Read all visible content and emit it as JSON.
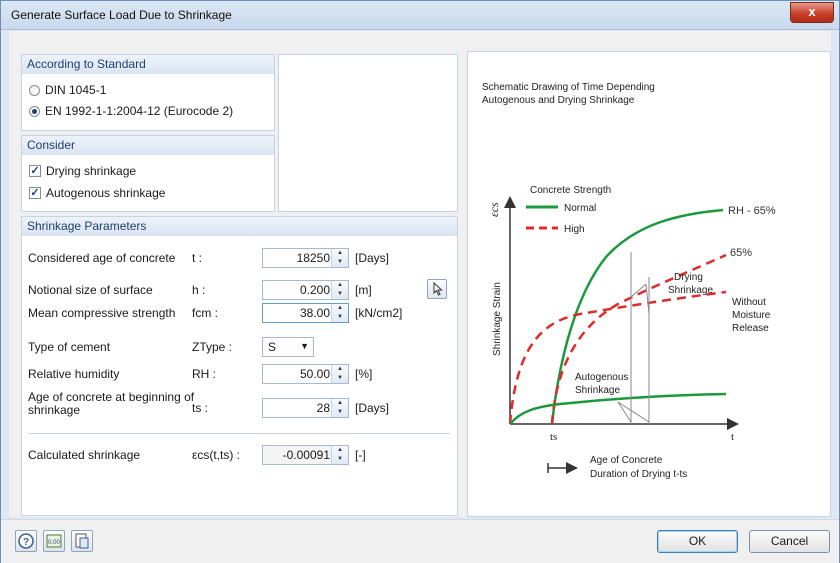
{
  "window": {
    "title": "Generate Surface Load Due to Shrinkage",
    "close_label": "x"
  },
  "standard": {
    "header": "According to Standard",
    "options": [
      "DIN 1045-1",
      "EN 1992-1-1:2004-12 (Eurocode 2)"
    ],
    "selected": "EN 1992-1-1:2004-12 (Eurocode 2)"
  },
  "consider": {
    "header": "Consider",
    "drying": "Drying shrinkage",
    "autogenous": "Autogenous shrinkage",
    "drying_checked": true,
    "autogenous_checked": true
  },
  "params": {
    "header": "Shrinkage Parameters",
    "age": {
      "label": "Considered age of concrete",
      "symbol": "t :",
      "value": "18250",
      "unit": "[Days]"
    },
    "notional": {
      "label": "Notional size of surface",
      "symbol": "h :",
      "value": "0.200",
      "unit": "[m]"
    },
    "strength": {
      "label": "Mean compressive strength",
      "symbol": "fcm :",
      "value": "38.00",
      "unit": "[kN/cm2]"
    },
    "cement": {
      "label": "Type of cement",
      "symbol": "ZType :",
      "value": "S"
    },
    "humidity": {
      "label": "Relative humidity",
      "symbol": "RH :",
      "value": "50.00",
      "unit": "[%]"
    },
    "ts": {
      "label_line1": "Age of concrete at beginning of",
      "label_line2": "shrinkage",
      "symbol": "ts :",
      "value": "28",
      "unit": "[Days]"
    },
    "result": {
      "label": "Calculated shrinkage",
      "symbol": "εcs(t,ts) :",
      "value": "-0.00091",
      "unit": "[-]"
    }
  },
  "diagram": {
    "title_line1": "Schematic Drawing of Time Depending",
    "title_line2": "Autogenous and Drying Shrinkage",
    "legend_title": "Concrete Strength",
    "legend_normal": "Normal",
    "legend_high": "High",
    "yaxis_symbol": "εcs",
    "yaxis_label": "Shrinkage Strain",
    "label_rh": "RH - 65%",
    "label_65": "65%",
    "label_drying_1": "Drying",
    "label_drying_2": "Shrinkage",
    "label_without_1": "Without",
    "label_without_2": "Moisture",
    "label_without_3": "Release",
    "label_auto_1": "Autogenous",
    "label_auto_2": "Shrinkage",
    "x_ts": "ts",
    "x_t": "t",
    "xcaption_1": "Age of Concrete",
    "xcaption_2": "Duration of Drying t-ts",
    "colors": {
      "normal": "#1a9a3c",
      "high": "#e02a2a"
    }
  },
  "buttons": {
    "ok": "OK",
    "cancel": "Cancel"
  },
  "toolbar_icons": [
    "help-icon",
    "decimal-places-icon",
    "export-icon"
  ]
}
